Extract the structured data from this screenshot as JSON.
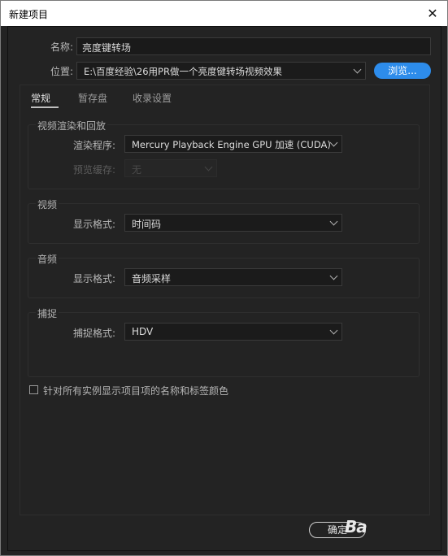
{
  "window": {
    "title": "新建项目",
    "close_label": "✕"
  },
  "name": {
    "label": "名称:",
    "value": "亮度键转场"
  },
  "location": {
    "label": "位置:",
    "value": "E:\\百度经验\\26用PR做一个亮度键转场视频效果",
    "browse_label": "浏览..."
  },
  "tabs": [
    {
      "label": "常规",
      "active": true
    },
    {
      "label": "暂存盘",
      "active": false
    },
    {
      "label": "收录设置",
      "active": false
    }
  ],
  "groups": {
    "render": {
      "title": "视频渲染和回放",
      "renderer_label": "渲染程序:",
      "renderer_value": "Mercury Playback Engine GPU 加速 (CUDA)",
      "preview_cache_label": "预览缓存:",
      "preview_cache_value": "无"
    },
    "video": {
      "title": "视频",
      "format_label": "显示格式:",
      "format_value": "时间码"
    },
    "audio": {
      "title": "音频",
      "format_label": "显示格式:",
      "format_value": "音频采样"
    },
    "capture": {
      "title": "捕捉",
      "format_label": "捕捉格式:",
      "format_value": "HDV"
    }
  },
  "checkbox": {
    "label": "针对所有实例显示项目项的名称和标签颜色",
    "checked": false
  },
  "footer": {
    "ok_label": "确定",
    "watermark_text": "Ba"
  },
  "colors": {
    "accent": "#2d8ceb",
    "background": "#232323"
  }
}
